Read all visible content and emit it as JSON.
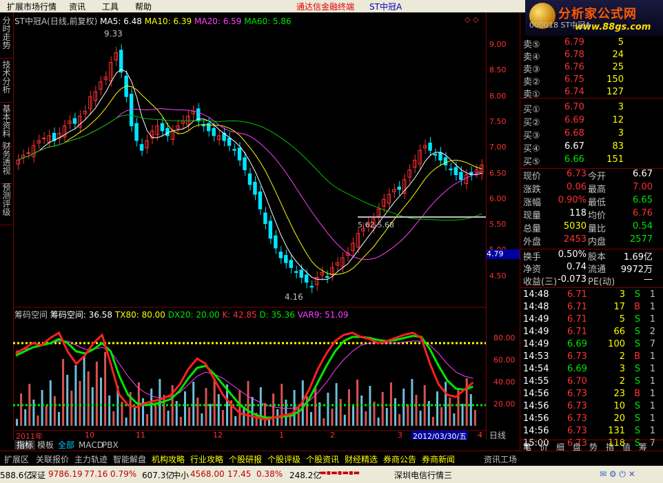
{
  "menu": {
    "items": [
      "扩展市场行情",
      "资讯",
      "工具",
      "帮助"
    ],
    "title": "通达信金融终端",
    "stock": "ST中冠A"
  },
  "logo": {
    "text": "分析家公式网",
    "url": "www.88gs.com",
    "code": "000018 ST中冠A"
  },
  "leftnav": [
    {
      "label": "分时走势"
    },
    {
      "label": "技术分析"
    },
    {
      "label": "基本资料"
    },
    {
      "label": "财务透视"
    },
    {
      "label": "预测评级"
    }
  ],
  "chart": {
    "header": {
      "title": "ST中冠A(日线,前复权)",
      "ma5": "MA5: 6.48",
      "ma10": "MA10: 6.39",
      "ma20": "MA20: 6.59",
      "ma60": "MA60: 5.86"
    },
    "high_label": "9.33",
    "low_label": "4.16",
    "gap_label": "5.62-5.68",
    "price_axis": [
      "9.00",
      "8.50",
      "8.00",
      "7.50",
      "7.00",
      "6.50",
      "6.00",
      "5.50",
      "5.00",
      "4.50"
    ],
    "price_tag": "4.79",
    "ind_header": {
      "name": "筹码空间",
      "label": "筹码空间: 36.58",
      "tx80": "TX80: 80.00",
      "dx20": "DX20: 20.00",
      "k": "K: 42.85",
      "d": "D: 35.36",
      "var9": "VAR9: 51.09"
    },
    "ind_axis": [
      "80.00",
      "60.00",
      "40.00",
      "20.00"
    ],
    "date_axis": [
      "2011年",
      "10",
      "11",
      "12",
      "1",
      "2",
      "3",
      "4"
    ],
    "cursor_date": "2012/03/30/五"
  },
  "chart_data": {
    "type": "candlestick",
    "ylim": [
      4.0,
      9.5
    ],
    "closes": [
      6.9,
      7.0,
      7.05,
      7.2,
      7.3,
      7.35,
      7.4,
      7.3,
      7.45,
      7.6,
      7.7,
      7.65,
      7.8,
      7.9,
      8.2,
      8.3,
      8.5,
      8.6,
      8.9,
      9.1,
      8.7,
      8.2,
      7.6,
      7.3,
      7.1,
      7.3,
      7.5,
      7.6,
      7.5,
      7.4,
      7.5,
      7.6,
      7.7,
      7.8,
      7.9,
      7.7,
      7.6,
      7.5,
      7.4,
      7.4,
      7.3,
      7.2,
      7.1,
      6.9,
      6.7,
      6.4,
      6.2,
      5.9,
      5.6,
      5.3,
      5.1,
      4.9,
      4.8,
      4.7,
      4.6,
      4.5,
      4.4,
      4.3,
      4.5,
      4.6,
      4.5,
      4.7,
      4.8,
      4.9,
      5.0,
      5.2,
      5.4,
      5.5,
      5.6,
      5.7,
      5.9,
      6.1,
      6.2,
      6.3,
      6.3,
      6.5,
      6.7,
      6.9,
      7.1,
      7.2,
      7.1,
      7.0,
      6.9,
      6.8,
      6.7,
      6.6,
      6.5,
      6.6,
      6.6,
      6.7,
      6.8
    ],
    "kline": [
      70,
      75,
      80,
      78,
      85,
      90,
      72,
      60,
      68,
      80,
      88,
      60,
      30,
      20,
      18,
      22,
      24,
      26,
      30,
      40,
      55,
      65,
      60,
      45,
      30,
      20,
      12,
      10,
      8,
      6,
      8,
      10,
      12,
      20,
      35,
      55,
      70,
      82,
      88,
      90,
      86,
      84,
      80,
      82,
      85,
      88,
      90,
      85,
      60,
      40,
      30,
      28,
      35,
      42
    ],
    "dline": [
      68,
      72,
      76,
      78,
      80,
      84,
      80,
      72,
      70,
      74,
      80,
      72,
      48,
      30,
      22,
      20,
      21,
      23,
      26,
      34,
      46,
      56,
      58,
      50,
      40,
      30,
      20,
      14,
      10,
      8,
      8,
      9,
      10,
      15,
      26,
      42,
      58,
      72,
      82,
      86,
      86,
      85,
      83,
      82,
      83,
      85,
      87,
      86,
      74,
      58,
      44,
      36,
      35,
      38
    ],
    "var9": [
      72,
      74,
      76,
      78,
      80,
      82,
      82,
      78,
      74,
      74,
      76,
      72,
      60,
      48,
      38,
      32,
      28,
      27,
      28,
      32,
      40,
      48,
      52,
      50,
      46,
      40,
      34,
      28,
      24,
      20,
      18,
      17,
      17,
      19,
      24,
      32,
      42,
      54,
      64,
      72,
      78,
      80,
      80,
      80,
      80,
      81,
      82,
      82,
      78,
      70,
      60,
      52,
      48,
      46
    ],
    "tx80": 80,
    "dx20": 20
  },
  "panel": {
    "asks": [
      {
        "l": "卖⑤",
        "p": "6.79",
        "v": "5"
      },
      {
        "l": "卖④",
        "p": "6.78",
        "v": "24"
      },
      {
        "l": "卖③",
        "p": "6.76",
        "v": "25"
      },
      {
        "l": "卖②",
        "p": "6.75",
        "v": "150"
      },
      {
        "l": "卖①",
        "p": "6.74",
        "v": "127"
      }
    ],
    "bids": [
      {
        "l": "买①",
        "p": "6.70",
        "v": "3"
      },
      {
        "l": "买②",
        "p": "6.69",
        "v": "12"
      },
      {
        "l": "买③",
        "p": "6.68",
        "v": "3"
      },
      {
        "l": "买④",
        "p": "6.67",
        "v": "83"
      },
      {
        "l": "买⑤",
        "p": "6.66",
        "v": "151"
      }
    ],
    "stats": [
      {
        "l1": "现价",
        "v1": "6.73",
        "l2": "今开",
        "v2": "6.67",
        "c1": "red",
        "c2": "white"
      },
      {
        "l1": "涨跌",
        "v1": "0.06",
        "l2": "最高",
        "v2": "7.00",
        "c1": "red",
        "c2": "red"
      },
      {
        "l1": "涨幅",
        "v1": "0.90%",
        "l2": "最低",
        "v2": "6.65",
        "c1": "red",
        "c2": "green"
      },
      {
        "l1": "现量",
        "v1": "118",
        "l2": "均价",
        "v2": "6.76",
        "c1": "white",
        "c2": "red"
      },
      {
        "l1": "总量",
        "v1": "5030",
        "l2": "量比",
        "v2": "0.54",
        "c1": "yel",
        "c2": "green"
      },
      {
        "l1": "外盘",
        "v1": "2453",
        "l2": "内盘",
        "v2": "2577",
        "c1": "red",
        "c2": "green"
      }
    ],
    "stats2": [
      {
        "l1": "换手",
        "v1": "0.50%",
        "l2": "股本",
        "v2": "1.69亿"
      },
      {
        "l1": "净资",
        "v1": "0.74",
        "l2": "流通",
        "v2": "9972万"
      },
      {
        "l1": "收益(三)",
        "v1": "-0.073",
        "l2": "PE(动)",
        "v2": "—"
      }
    ],
    "ticks": [
      {
        "t": "14:48",
        "p": "6.71",
        "v": "3",
        "s": "S",
        "n": "1"
      },
      {
        "t": "14:48",
        "p": "6.71",
        "v": "17",
        "s": "B",
        "n": "1"
      },
      {
        "t": "14:49",
        "p": "6.71",
        "v": "5",
        "s": "S",
        "n": "1"
      },
      {
        "t": "14:49",
        "p": "6.71",
        "v": "66",
        "s": "S",
        "n": "2"
      },
      {
        "t": "14:49",
        "p": "6.69",
        "v": "100",
        "s": "S",
        "n": "7"
      },
      {
        "t": "14:53",
        "p": "6.73",
        "v": "2",
        "s": "B",
        "n": "1"
      },
      {
        "t": "14:54",
        "p": "6.69",
        "v": "3",
        "s": "S",
        "n": "1"
      },
      {
        "t": "14:55",
        "p": "6.70",
        "v": "2",
        "s": "S",
        "n": "1"
      },
      {
        "t": "14:56",
        "p": "6.73",
        "v": "23",
        "s": "B",
        "n": "1"
      },
      {
        "t": "14:56",
        "p": "6.73",
        "v": "10",
        "s": "S",
        "n": "1"
      },
      {
        "t": "14:56",
        "p": "6.73",
        "v": "20",
        "s": "S",
        "n": "1"
      },
      {
        "t": "14:56",
        "p": "6.73",
        "v": "131",
        "s": "S",
        "n": "1"
      },
      {
        "t": "15:00",
        "p": "6.73",
        "v": "118",
        "s": "S",
        "n": "7"
      }
    ],
    "period": "日线",
    "tabs": [
      "笔",
      "价",
      "细",
      "盘",
      "势",
      "指",
      "值",
      "筹"
    ]
  },
  "tabsbar": [
    "指标",
    "模板",
    "全部",
    "MACD",
    "PBX"
  ],
  "btmnav": [
    "扩展区",
    "关联报价",
    "主力轨迹",
    "智能解盘",
    "机构攻略",
    "行业攻略",
    "个股研报",
    "个股评级",
    "个股资讯",
    "财经精选",
    "券商公告",
    "券商新闻",
    "资讯工场"
  ],
  "status": {
    "s1": "588.6亿",
    "sz": "深证",
    "sz_v": "9786.19",
    "sz_c": "77.16",
    "sz_p": "0.79%",
    "s2": "607.3亿",
    "zx": "中小",
    "zx_v": "4568.00",
    "zx_c": "17.45",
    "zx_p": "0.38%",
    "s3": "248.2亿",
    "line": "深圳电信行情三"
  }
}
